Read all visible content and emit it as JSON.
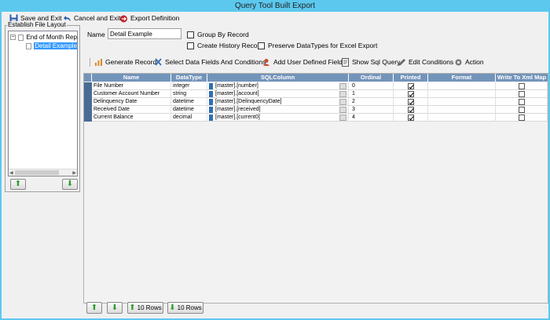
{
  "window": {
    "title": "Query Tool Built Export"
  },
  "toolbar": {
    "save_exit": "Save and Exit",
    "cancel_exit": "Cancel and Exit",
    "export_definition": "Export Definition"
  },
  "file_layout": {
    "legend": "Establish File Layout",
    "tree": {
      "root": "End of Month Repor",
      "child": "Detail Example"
    },
    "up_icon": "green-up-arrow",
    "down_icon": "green-down-arrow"
  },
  "form": {
    "name_label": "Name",
    "name_value": "Detail Example",
    "group_by_record": {
      "label": "Group By Record",
      "checked": false
    },
    "create_history_record": {
      "label": "Create History Record",
      "checked": false
    },
    "preserve_datatypes": {
      "label": "Preserve DataTypes for Excel Export",
      "checked": false
    }
  },
  "actions": {
    "generate_record": "Generate Record",
    "select_fields": "Select Data Fields And Conditions",
    "add_udf": "Add User Defined Field",
    "show_sql": "Show Sql Query",
    "edit_conditions": "Edit Conditions",
    "action": "Action"
  },
  "grid": {
    "columns": [
      "Name",
      "DataType",
      "SQLColumn",
      "Ordinal",
      "Printed",
      "Format",
      "Write To Xml Map"
    ],
    "rows": [
      {
        "name": "File Number",
        "datatype": "integer",
        "sql": "[master].[number]",
        "ordinal": "0",
        "printed": true,
        "format": "",
        "xml": false
      },
      {
        "name": "Customer Account Number",
        "datatype": "string",
        "sql": "[master].[account]",
        "ordinal": "1",
        "printed": true,
        "format": "",
        "xml": false
      },
      {
        "name": "Delinquency Date",
        "datatype": "datetime",
        "sql": "[master].[DelinquencyDate]",
        "ordinal": "2",
        "printed": true,
        "format": "",
        "xml": false
      },
      {
        "name": "Received Date",
        "datatype": "datetime",
        "sql": "[master].[received]",
        "ordinal": "3",
        "printed": true,
        "format": "",
        "xml": false
      },
      {
        "name": "Current Balance",
        "datatype": "decimal",
        "sql": "[master].[current0]",
        "ordinal": "4",
        "printed": true,
        "format": "",
        "xml": false
      }
    ]
  },
  "bottom": {
    "up_10": "10 Rows",
    "down_10": "10 Rows"
  },
  "colors": {
    "header": "#7394ba",
    "title_bar": "#5cc8ee",
    "accent_green": "#2e9b2e"
  }
}
